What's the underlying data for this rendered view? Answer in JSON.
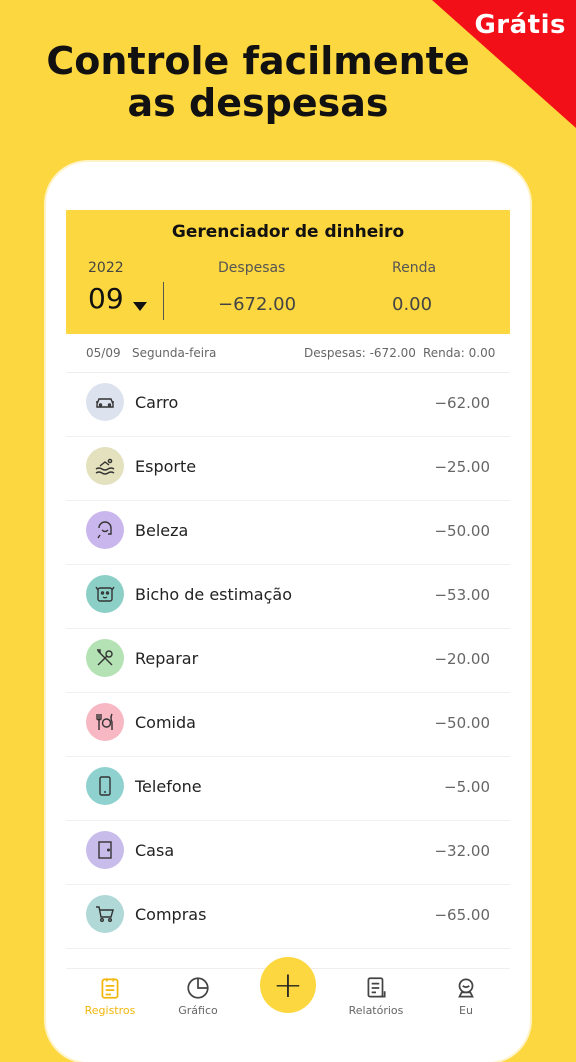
{
  "promo": {
    "badge": "Grátis",
    "headline": "Controle facilmente as despesas"
  },
  "app": {
    "title": "Gerenciador de dinheiro",
    "year": "2022",
    "month": "09",
    "expenses_label": "Despesas",
    "expenses_value": "−672.00",
    "income_label": "Renda",
    "income_value": "0.00"
  },
  "day": {
    "date": "05/09",
    "weekday": "Segunda-feira",
    "expenses": "Despesas: -672.00",
    "income": "Renda: 0.00"
  },
  "records": [
    {
      "name": "Carro",
      "amount": "−62.00",
      "icon": "car-icon",
      "color": "#DCE3EE"
    },
    {
      "name": "Esporte",
      "amount": "−25.00",
      "icon": "swim-icon",
      "color": "#E3E1BE"
    },
    {
      "name": "Beleza",
      "amount": "−50.00",
      "icon": "beauty-icon",
      "color": "#C9B6EC"
    },
    {
      "name": "Bicho de estimação",
      "amount": "−53.00",
      "icon": "pet-icon",
      "color": "#8CCFC7"
    },
    {
      "name": "Reparar",
      "amount": "−20.00",
      "icon": "repair-icon",
      "color": "#B4E2B4"
    },
    {
      "name": "Comida",
      "amount": "−50.00",
      "icon": "food-icon",
      "color": "#F7B8C4"
    },
    {
      "name": "Telefone",
      "amount": "−5.00",
      "icon": "phone-icon",
      "color": "#8FD1CE"
    },
    {
      "name": "Casa",
      "amount": "−32.00",
      "icon": "house-icon",
      "color": "#C8BCEB"
    },
    {
      "name": "Compras",
      "amount": "−65.00",
      "icon": "cart-icon",
      "color": "#AFD8D7"
    }
  ],
  "nav": {
    "records": "Registros",
    "chart": "Gráfico",
    "add": "+",
    "reports": "Relatórios",
    "me": "Eu"
  },
  "colors": {
    "accent": "#FDD73F",
    "badge": "#F30F17",
    "active_nav": "#F2B70B"
  }
}
